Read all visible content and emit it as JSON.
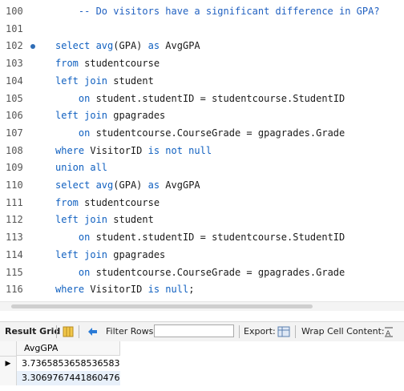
{
  "editor": {
    "lines": [
      {
        "num": "100",
        "segments": [
          {
            "t": "    -- Do visitors have a significant difference in GPA?",
            "c": "cm"
          }
        ]
      },
      {
        "num": "101",
        "segments": []
      },
      {
        "num": "102",
        "marker": true,
        "segments": [
          {
            "t": "select ",
            "c": "kw"
          },
          {
            "t": "avg",
            "c": "kw"
          },
          {
            "t": "(GPA) ",
            "c": ""
          },
          {
            "t": "as",
            "c": "kw"
          },
          {
            "t": " AvgGPA",
            "c": ""
          }
        ]
      },
      {
        "num": "103",
        "segments": [
          {
            "t": "from",
            "c": "kw"
          },
          {
            "t": " studentcourse",
            "c": ""
          }
        ]
      },
      {
        "num": "104",
        "segments": [
          {
            "t": "left join",
            "c": "kw"
          },
          {
            "t": " student",
            "c": ""
          }
        ]
      },
      {
        "num": "105",
        "segments": [
          {
            "t": "    on",
            "c": "kw"
          },
          {
            "t": " student.studentID = studentcourse.StudentID",
            "c": ""
          }
        ]
      },
      {
        "num": "106",
        "segments": [
          {
            "t": "left join",
            "c": "kw"
          },
          {
            "t": " gpagrades",
            "c": ""
          }
        ]
      },
      {
        "num": "107",
        "segments": [
          {
            "t": "    on",
            "c": "kw"
          },
          {
            "t": " studentcourse.CourseGrade = gpagrades.Grade",
            "c": ""
          }
        ]
      },
      {
        "num": "108",
        "segments": [
          {
            "t": "where",
            "c": "kw"
          },
          {
            "t": " VisitorID ",
            "c": ""
          },
          {
            "t": "is not null",
            "c": "kw"
          }
        ]
      },
      {
        "num": "109",
        "segments": [
          {
            "t": "union all",
            "c": "kw"
          }
        ]
      },
      {
        "num": "110",
        "segments": [
          {
            "t": "select ",
            "c": "kw"
          },
          {
            "t": "avg",
            "c": "kw"
          },
          {
            "t": "(GPA) ",
            "c": ""
          },
          {
            "t": "as",
            "c": "kw"
          },
          {
            "t": " AvgGPA",
            "c": ""
          }
        ]
      },
      {
        "num": "111",
        "segments": [
          {
            "t": "from",
            "c": "kw"
          },
          {
            "t": " studentcourse",
            "c": ""
          }
        ]
      },
      {
        "num": "112",
        "segments": [
          {
            "t": "left join",
            "c": "kw"
          },
          {
            "t": " student",
            "c": ""
          }
        ]
      },
      {
        "num": "113",
        "segments": [
          {
            "t": "    on",
            "c": "kw"
          },
          {
            "t": " student.studentID = studentcourse.StudentID",
            "c": ""
          }
        ]
      },
      {
        "num": "114",
        "segments": [
          {
            "t": "left join",
            "c": "kw"
          },
          {
            "t": " gpagrades",
            "c": ""
          }
        ]
      },
      {
        "num": "115",
        "segments": [
          {
            "t": "    on",
            "c": "kw"
          },
          {
            "t": " studentcourse.CourseGrade = gpagrades.Grade",
            "c": ""
          }
        ]
      },
      {
        "num": "116",
        "segments": [
          {
            "t": "where",
            "c": "kw"
          },
          {
            "t": " VisitorID ",
            "c": ""
          },
          {
            "t": "is null",
            "c": "kw"
          },
          {
            "t": ";",
            "c": ""
          }
        ]
      }
    ]
  },
  "toolbar": {
    "result_grid_label": "Result Grid",
    "filter_rows_label": "Filter Rows:",
    "filter_rows_value": "",
    "export_label": "Export:",
    "wrap_label": "Wrap Cell Content:",
    "icons": [
      "grid-form-icon",
      "refresh-arrows-icon",
      "export-icon",
      "wrap-text-icon"
    ]
  },
  "grid": {
    "columns": [
      "AvgGPA"
    ],
    "rows": [
      [
        "3.7365853658536583"
      ],
      [
        "3.3069767441860476"
      ]
    ],
    "selected_row": 0
  },
  "colors": {
    "keyword": "#1060c0",
    "comment": "#2060c0",
    "marker": "#2f6db6"
  }
}
